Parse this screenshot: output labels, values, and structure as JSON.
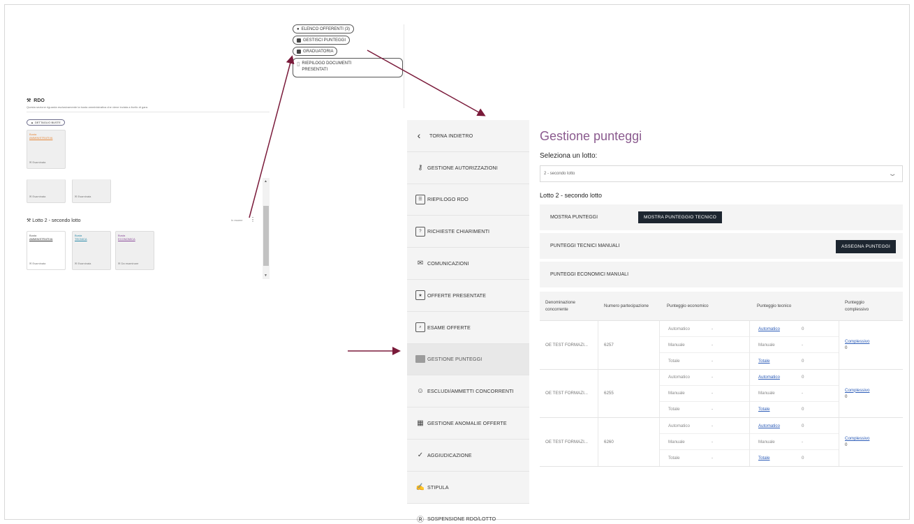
{
  "left_panel": {
    "rdo_title": "RDO",
    "rdo_desc": "Questa sezione riguarda esclusivamente la busta amministrativa che viene inviata a livello di gara.",
    "dettaglio_buste": "DETTAGLIO BUSTE",
    "card_busta": "Busta",
    "card_amm": "AMMINISTRATIVA",
    "card_tecnica": "TECNICA",
    "card_economica": "ECONOMICA",
    "esaminata": "Esaminata",
    "da_esaminare": "Da esaminare",
    "lotto_title": "Lotto 2 - secondo lotto",
    "in_esame": "In esame",
    "dots": "⋮"
  },
  "popup": {
    "items": [
      "ELENCO OFFERENTI (3)",
      "GESTISCI PUNTEGGI",
      "GRADUATORIA",
      "RIEPILOGO DOCUMENTI PRESENTATI"
    ]
  },
  "sidebar": {
    "back": "TORNA INDIETRO",
    "items": [
      {
        "label": "GESTIONE AUTORIZZAZIONI",
        "icon": "⚷"
      },
      {
        "label": "RIEPILOGO RDO",
        "icon": "☰"
      },
      {
        "label": "RICHIESTE CHIARIMENTI",
        "icon": "?"
      },
      {
        "label": "COMUNICAZIONI",
        "icon": "✉"
      },
      {
        "label": "OFFERTE PRESENTATE",
        "icon": "★"
      },
      {
        "label": "ESAME OFFERTE",
        "icon": "⌕"
      },
      {
        "label": "GESTIONE PUNTEGGI",
        "icon": ""
      },
      {
        "label": "ESCLUDI/AMMETTI CONCORRENTI",
        "icon": "☺"
      },
      {
        "label": "GESTIONE ANOMALIE OFFERTE",
        "icon": "▦"
      },
      {
        "label": "AGGIUDICAZIONE",
        "icon": "✓"
      },
      {
        "label": "STIPULA",
        "icon": "✍"
      },
      {
        "label": "SOSPENSIONE RDO/LOTTO",
        "icon": "Ⓡ"
      }
    ]
  },
  "main": {
    "title": "Gestione punteggi",
    "select_label": "Seleziona un lotto:",
    "select_value": "2 - secondo lotto",
    "lot_label": "Lotto 2 - secondo lotto",
    "band1_label": "MOSTRA PUNTEGGI",
    "band1_button": "MOSTRA PUNTEGGIO TECNICO",
    "band2_label": "PUNTEGGI TECNICI MANUALI",
    "band2_button": "ASSEGNA PUNTEGGI",
    "band3_label": "PUNTEGGI ECONOMICI MANUALI",
    "table": {
      "headers": [
        "Denominazione concorrente",
        "Numero partecipazione",
        "Punteggio economico",
        "Punteggio tecnico",
        "Punteggio complessivo"
      ],
      "rows": [
        {
          "name": "OE TEST FORMAZI...",
          "num": "6257",
          "eco": [
            [
              "Automatico",
              "-"
            ],
            [
              "Manuale",
              "-"
            ],
            [
              "Totale",
              "-"
            ]
          ],
          "tec": [
            [
              "Automatico",
              "0"
            ],
            [
              "Manuale",
              "-"
            ],
            [
              "Totale",
              "0"
            ]
          ],
          "comp_link": "Complessivo",
          "comp_val": "0"
        },
        {
          "name": "OE TEST FORMAZI...",
          "num": "6255",
          "eco": [
            [
              "Automatico",
              "-"
            ],
            [
              "Manuale",
              "-"
            ],
            [
              "Totale",
              "-"
            ]
          ],
          "tec": [
            [
              "Automatico",
              "0"
            ],
            [
              "Manuale",
              "-"
            ],
            [
              "Totale",
              "0"
            ]
          ],
          "comp_link": "Complessivo",
          "comp_val": "0"
        },
        {
          "name": "OE TEST FORMAZI...",
          "num": "6260",
          "eco": [
            [
              "Automatico",
              "-"
            ],
            [
              "Manuale",
              "-"
            ],
            [
              "Totale",
              "-"
            ]
          ],
          "tec": [
            [
              "Automatico",
              "0"
            ],
            [
              "Manuale",
              "-"
            ],
            [
              "Totale",
              "0"
            ]
          ],
          "comp_link": "Complessivo",
          "comp_val": "0"
        }
      ]
    }
  },
  "colors": {
    "title": "#8a5a8e",
    "dark_button": "#1d2630",
    "arrow": "#7a1a3a",
    "link": "#2c5cb8"
  }
}
